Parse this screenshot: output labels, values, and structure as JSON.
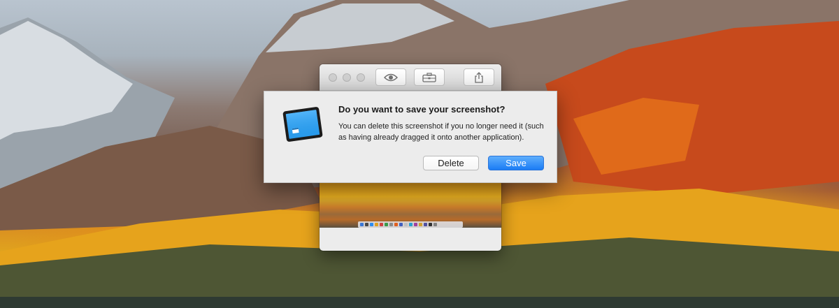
{
  "preview_window": {
    "toolbar": [
      {
        "icon": "eye-icon"
      },
      {
        "icon": "toolbox-icon"
      },
      {
        "icon": "share-icon"
      }
    ]
  },
  "dialog": {
    "title": "Do you want to save your screenshot?",
    "message": "You can delete this screenshot if you no longer need it (such as having already dragged it onto another application).",
    "delete_label": "Delete",
    "save_label": "Save",
    "app_icon": "screenshot-app-icon"
  },
  "colors": {
    "accent_button": "#1a7cf5",
    "dialog_bg": "#ececec"
  }
}
